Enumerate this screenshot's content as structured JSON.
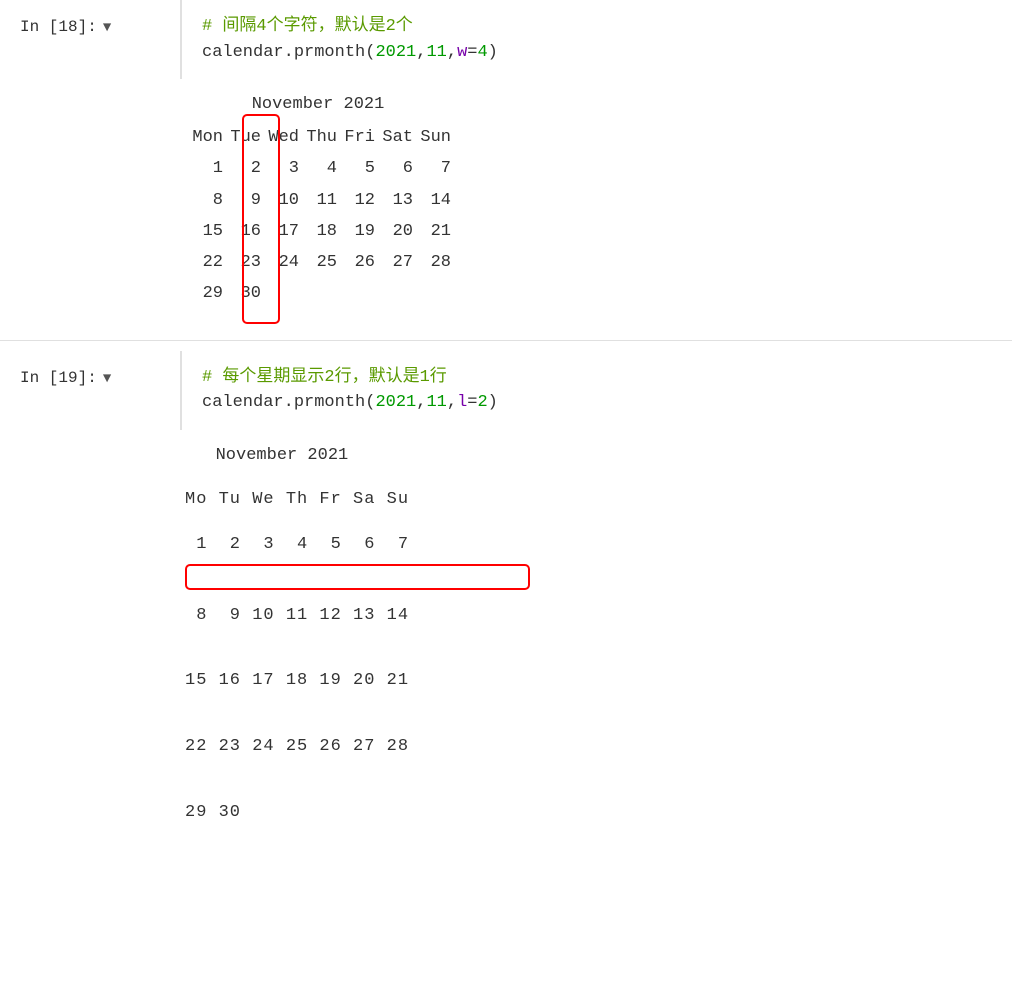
{
  "cell18": {
    "label": "In [18]:",
    "arrow": "▼",
    "comment": "# 间隔4个字符，默认是2个",
    "code": "calendar.prmonth(2021,11,w=4)",
    "code_parts": {
      "func": "calendar.prmonth(",
      "n1": "2021",
      "comma1": ",",
      "n2": "11",
      "comma2": ",",
      "param": "w",
      "eq": "=",
      "n3": "4",
      "paren": ")"
    }
  },
  "output18": {
    "title": "   November 2021",
    "header": "Mon  Tue  Wed  Thu  Fri  Sat  Sun",
    "weeks": [
      " 1    2    3    4    5    6    7",
      " 8    9   10   11   12   13   14",
      "15   16   17   18   19   20   21",
      "22   23   24   25   26   27   28",
      "29   30"
    ]
  },
  "cell19": {
    "label": "In [19]:",
    "arrow": "▼",
    "comment": "# 每个星期显示2行，默认是1行",
    "code": "calendar.prmonth(2021,11,l=2)",
    "code_parts": {
      "func": "calendar.prmonth(",
      "n1": "2021",
      "comma1": ",",
      "n2": "11",
      "comma2": ",",
      "param": "l",
      "eq": "=",
      "n3": "2",
      "paren": ")"
    }
  },
  "output19": {
    "title": "   November 2021",
    "header": "Mo Tu We Th Fr Sa Su",
    "weeks": [
      " 1  2  3  4  5  6  7",
      "",
      " 8  9 10 11 12 13 14",
      "",
      "15 16 17 18 19 20 21",
      "",
      "22 23 24 25 26 27 28",
      "",
      "29 30"
    ]
  },
  "colors": {
    "comment": "#5a9a00",
    "green": "#008800",
    "purple": "#7700aa",
    "number": "#009900",
    "red": "#cc0000"
  }
}
